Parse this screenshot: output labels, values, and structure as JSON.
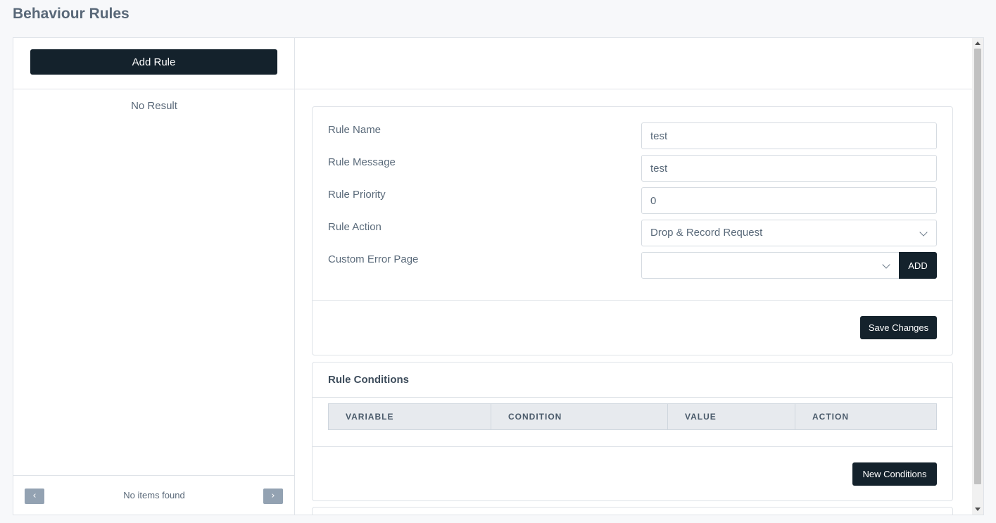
{
  "page": {
    "title": "Behaviour Rules"
  },
  "sidebar": {
    "add_rule_label": "Add Rule",
    "empty_text": "No Result",
    "pager": {
      "prev_icon": "chevron-left-icon",
      "next_icon": "chevron-right-icon",
      "prev_glyph": "‹",
      "next_glyph": "›",
      "status": "No items found"
    }
  },
  "form": {
    "rule_name": {
      "label": "Rule Name",
      "value": "test"
    },
    "rule_message": {
      "label": "Rule Message",
      "value": "test"
    },
    "rule_priority": {
      "label": "Rule Priority",
      "value": "0"
    },
    "rule_action": {
      "label": "Rule Action",
      "value": "Drop & Record Request"
    },
    "custom_error_page": {
      "label": "Custom Error Page",
      "value": "",
      "add_label": "ADD"
    },
    "save_label": "Save Changes"
  },
  "conditions": {
    "title": "Rule Conditions",
    "columns": [
      "VARIABLE",
      "CONDITION",
      "VALUE",
      "ACTION"
    ],
    "new_label": "New Conditions"
  },
  "colors": {
    "primary_button": "#14222c",
    "background": "#f7f8fa",
    "pager_button": "#93a2b2"
  }
}
